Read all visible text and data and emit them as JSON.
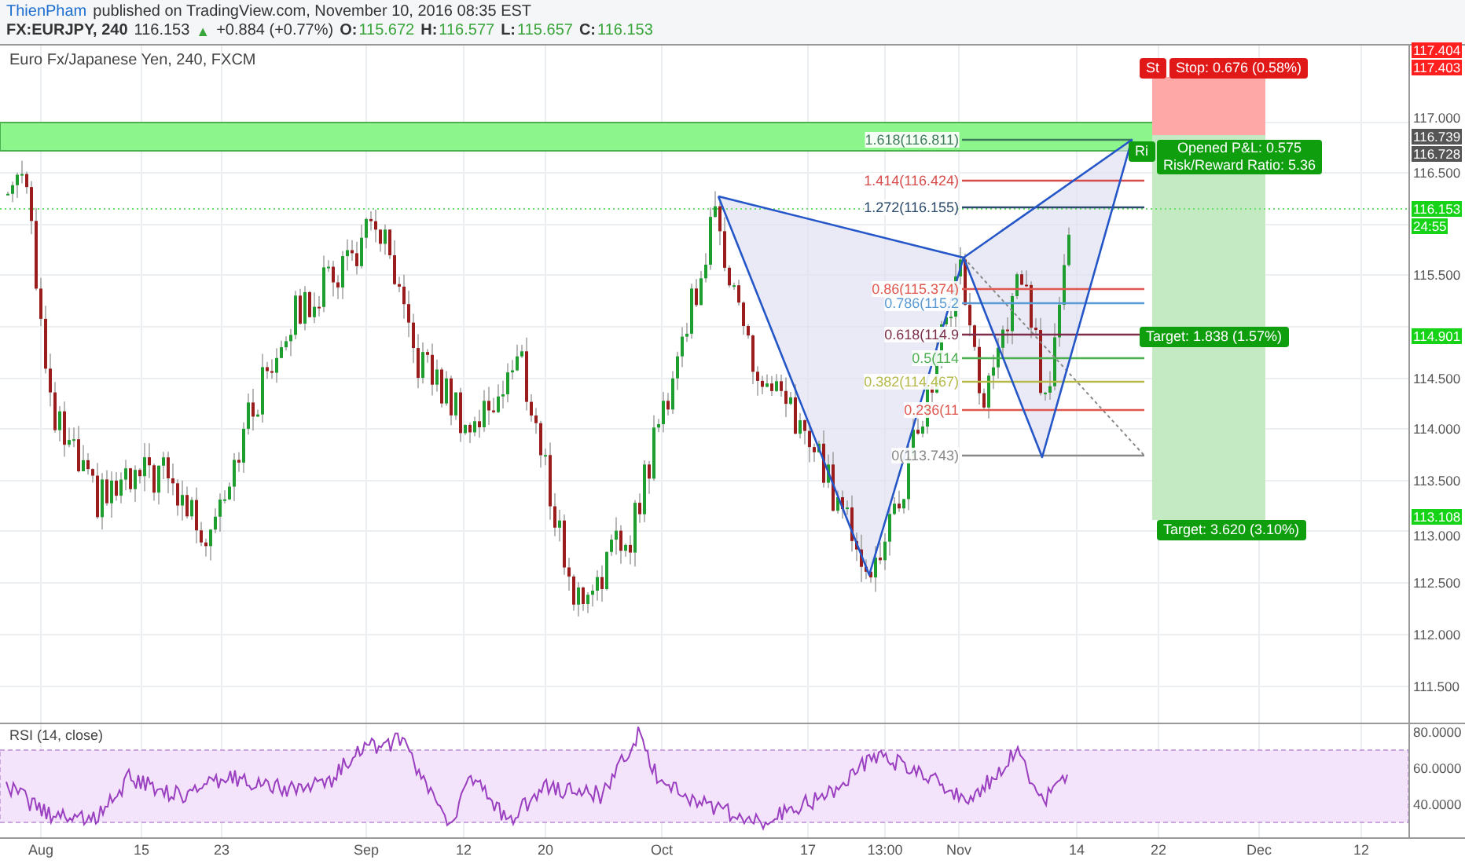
{
  "header": {
    "author": "ThienPham",
    "published": "published on TradingView.com, November 10, 2016 08:35 EST",
    "symbol": "FX:EURJPY, 240",
    "last": "116.153",
    "arrow": "▲",
    "change": "+0.884 (+0.77%)",
    "ohlc": [
      {
        "label": "O:",
        "value": "115.672"
      },
      {
        "label": "H:",
        "value": "116.577"
      },
      {
        "label": "L:",
        "value": "115.657"
      },
      {
        "label": "C:",
        "value": "116.153"
      }
    ]
  },
  "chart": {
    "title": "Euro Fx/Japanese Yen, 240, FXCM",
    "fib_levels": [
      {
        "label": "1.618(116.811)",
        "color": "#3d7a5a"
      },
      {
        "label": "1.414(116.424)",
        "color": "#d84b4b"
      },
      {
        "label": "1.272(116.155)",
        "color": "#2c4a6b"
      },
      {
        "label": "0.86(115.374)",
        "color": "#e0574f"
      },
      {
        "label": "0.786(115.2",
        "color": "#5b9bd5"
      },
      {
        "label": "0.618(114.9",
        "color": "#7b2d4a"
      },
      {
        "label": "0.5(114",
        "color": "#4caf50"
      },
      {
        "label": "0.382(114.467)",
        "color": "#b5b94a"
      },
      {
        "label": "0.236(11",
        "color": "#e0574f"
      },
      {
        "label": "0(113.743)",
        "color": "#888888"
      }
    ],
    "position": {
      "stop_fragment": "St",
      "stop": "Stop: 0.676 (0.58%)",
      "pnl_fragment": "Ri",
      "pnl": "Opened P&L: 0.575",
      "ratio": "Risk/Reward Ratio: 5.36",
      "targets": [
        "Target: 1.838 (1.57%)",
        "Target: 3.620 (3.10%)"
      ]
    },
    "price_axis": [
      {
        "text": "117.404",
        "kind": "red"
      },
      {
        "text": "117.403",
        "kind": "red"
      },
      {
        "text": "117.000",
        "kind": "plain"
      },
      {
        "text": "116.739",
        "kind": "dark"
      },
      {
        "text": "116.728",
        "kind": "dark"
      },
      {
        "text": "116.500",
        "kind": "plain"
      },
      {
        "text": "116.153",
        "kind": "green"
      },
      {
        "text": "24:55",
        "kind": "green"
      },
      {
        "text": "115.500",
        "kind": "plain"
      },
      {
        "text": "114.901",
        "kind": "green"
      },
      {
        "text": "114.500",
        "kind": "plain"
      },
      {
        "text": "114.000",
        "kind": "plain"
      },
      {
        "text": "113.500",
        "kind": "plain"
      },
      {
        "text": "113.108",
        "kind": "green"
      },
      {
        "text": "113.000",
        "kind": "plain"
      },
      {
        "text": "112.500",
        "kind": "plain"
      },
      {
        "text": "112.000",
        "kind": "plain"
      },
      {
        "text": "111.500",
        "kind": "plain"
      }
    ]
  },
  "rsi": {
    "title": "RSI (14, close)",
    "axis": [
      "80.0000",
      "60.0000",
      "40.0000"
    ]
  },
  "date_axis": [
    "Aug",
    "15",
    "23",
    "Sep",
    "12",
    "20",
    "Oct",
    "17",
    "13:00",
    "Nov",
    "14",
    "22",
    "Dec",
    "12"
  ]
}
